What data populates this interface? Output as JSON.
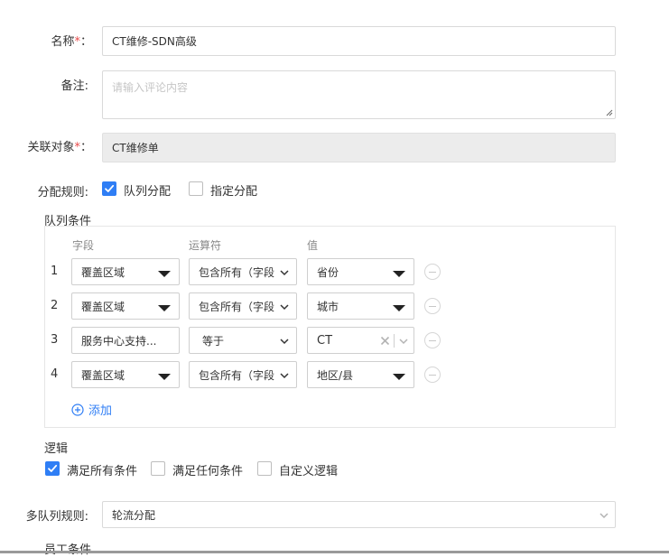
{
  "form": {
    "name_label": "名称",
    "name_required": "*",
    "name_colon": "：",
    "name_value": "CT维修-SDN高级",
    "remark_label": "备注:",
    "remark_placeholder": "请输入评论内容",
    "related_label": "关联对象",
    "related_required": "*",
    "related_colon": "：",
    "related_value": "CT维修单",
    "assign_label": "分配规则:",
    "assign_options": [
      {
        "label": "队列分配",
        "checked": true
      },
      {
        "label": "指定分配",
        "checked": false
      }
    ]
  },
  "queue_conditions": {
    "title": "队列条件",
    "headers": {
      "field": "字段",
      "operator": "运算符",
      "value": "值"
    },
    "rows": [
      {
        "num": "1",
        "field": "覆盖区域",
        "operator": "包含所有（字段",
        "value": "省份"
      },
      {
        "num": "2",
        "field": "覆盖区域",
        "operator": "包含所有（字段",
        "value": "城市"
      },
      {
        "num": "3",
        "field": "服务中心支持...",
        "operator": "等于",
        "value": "CT"
      },
      {
        "num": "4",
        "field": "覆盖区域",
        "operator": "包含所有（字段",
        "value": "地区/县"
      }
    ],
    "add_label": "添加"
  },
  "logic": {
    "title": "逻辑",
    "options": [
      {
        "label": "满足所有条件",
        "checked": true
      },
      {
        "label": "满足任何条件",
        "checked": false
      },
      {
        "label": "自定义逻辑",
        "checked": false
      }
    ]
  },
  "multi_queue": {
    "label": "多队列规则:",
    "value": "轮流分配"
  },
  "staff_conditions": {
    "title": "员工条件"
  },
  "colors": {
    "accent": "#2f7ef5",
    "required": "#e94b4b",
    "disabled_bg": "#ececec"
  }
}
